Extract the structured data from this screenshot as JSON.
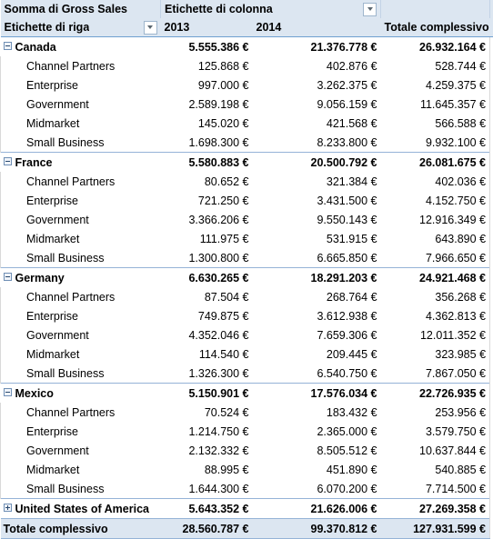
{
  "header": {
    "value_field_label": "Somma di Gross Sales",
    "column_labels_label": "Etichette di colonna",
    "row_labels_label": "Etichette di riga",
    "column_filter_icon": "chevron-down-icon",
    "row_filter_icon": "chevron-down-icon",
    "columns": [
      "2013",
      "2014",
      "Totale complessivo"
    ]
  },
  "colors": {
    "header_fill": "#DCE6F1",
    "total_fill": "#DCE6F1",
    "rule": "#95B3D7",
    "grid": "#D9D9D9"
  },
  "rows": [
    {
      "type": "country",
      "name": "Canada",
      "state": "expanded",
      "toggle_icon": "minus-box-icon",
      "v2013": "5.555.386 €",
      "v2014": "21.376.778 €",
      "total": "26.932.164 €",
      "children": [
        {
          "name": "Channel Partners",
          "v2013": "125.868 €",
          "v2014": "402.876 €",
          "total": "528.744 €"
        },
        {
          "name": "Enterprise",
          "v2013": "997.000 €",
          "v2014": "3.262.375 €",
          "total": "4.259.375 €"
        },
        {
          "name": "Government",
          "v2013": "2.589.198 €",
          "v2014": "9.056.159 €",
          "total": "11.645.357 €"
        },
        {
          "name": "Midmarket",
          "v2013": "145.020 €",
          "v2014": "421.568 €",
          "total": "566.588 €"
        },
        {
          "name": "Small Business",
          "v2013": "1.698.300 €",
          "v2014": "8.233.800 €",
          "total": "9.932.100 €"
        }
      ]
    },
    {
      "type": "country",
      "name": "France",
      "state": "expanded",
      "toggle_icon": "minus-box-icon",
      "v2013": "5.580.883 €",
      "v2014": "20.500.792 €",
      "total": "26.081.675 €",
      "children": [
        {
          "name": "Channel Partners",
          "v2013": "80.652 €",
          "v2014": "321.384 €",
          "total": "402.036 €"
        },
        {
          "name": "Enterprise",
          "v2013": "721.250 €",
          "v2014": "3.431.500 €",
          "total": "4.152.750 €"
        },
        {
          "name": "Government",
          "v2013": "3.366.206 €",
          "v2014": "9.550.143 €",
          "total": "12.916.349 €"
        },
        {
          "name": "Midmarket",
          "v2013": "111.975 €",
          "v2014": "531.915 €",
          "total": "643.890 €"
        },
        {
          "name": "Small Business",
          "v2013": "1.300.800 €",
          "v2014": "6.665.850 €",
          "total": "7.966.650 €"
        }
      ]
    },
    {
      "type": "country",
      "name": "Germany",
      "state": "expanded",
      "toggle_icon": "minus-box-icon",
      "v2013": "6.630.265 €",
      "v2014": "18.291.203 €",
      "total": "24.921.468 €",
      "children": [
        {
          "name": "Channel Partners",
          "v2013": "87.504 €",
          "v2014": "268.764 €",
          "total": "356.268 €"
        },
        {
          "name": "Enterprise",
          "v2013": "749.875 €",
          "v2014": "3.612.938 €",
          "total": "4.362.813 €"
        },
        {
          "name": "Government",
          "v2013": "4.352.046 €",
          "v2014": "7.659.306 €",
          "total": "12.011.352 €"
        },
        {
          "name": "Midmarket",
          "v2013": "114.540 €",
          "v2014": "209.445 €",
          "total": "323.985 €"
        },
        {
          "name": "Small Business",
          "v2013": "1.326.300 €",
          "v2014": "6.540.750 €",
          "total": "7.867.050 €"
        }
      ]
    },
    {
      "type": "country",
      "name": "Mexico",
      "state": "expanded",
      "toggle_icon": "minus-box-icon",
      "v2013": "5.150.901 €",
      "v2014": "17.576.034 €",
      "total": "22.726.935 €",
      "children": [
        {
          "name": "Channel Partners",
          "v2013": "70.524 €",
          "v2014": "183.432 €",
          "total": "253.956 €"
        },
        {
          "name": "Enterprise",
          "v2013": "1.214.750 €",
          "v2014": "2.365.000 €",
          "total": "3.579.750 €"
        },
        {
          "name": "Government",
          "v2013": "2.132.332 €",
          "v2014": "8.505.512 €",
          "total": "10.637.844 €"
        },
        {
          "name": "Midmarket",
          "v2013": "88.995 €",
          "v2014": "451.890 €",
          "total": "540.885 €"
        },
        {
          "name": "Small Business",
          "v2013": "1.644.300 €",
          "v2014": "6.070.200 €",
          "total": "7.714.500 €"
        }
      ]
    },
    {
      "type": "country",
      "name": "United States of America",
      "state": "collapsed",
      "toggle_icon": "plus-box-icon",
      "v2013": "5.643.352 €",
      "v2014": "21.626.006 €",
      "total": "27.269.358 €",
      "children": []
    }
  ],
  "grand_total": {
    "label": "Totale complessivo",
    "v2013": "28.560.787 €",
    "v2014": "99.370.812 €",
    "total": "127.931.599 €"
  }
}
